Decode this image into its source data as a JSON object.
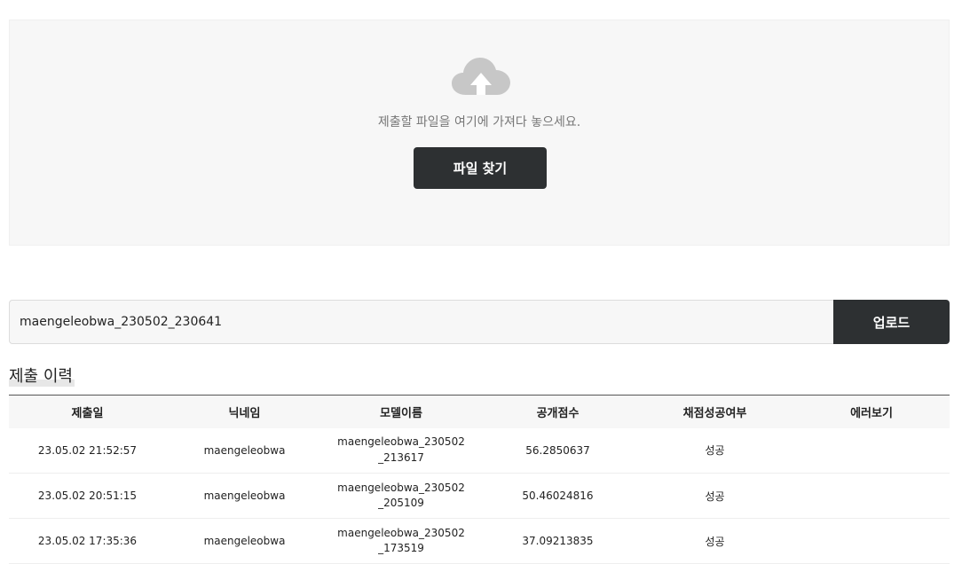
{
  "dropzone": {
    "hint": "제출할 파일을 여기에 가져다 놓으세요.",
    "find_button": "파일 찾기",
    "icon": "cloud-upload-icon"
  },
  "upload": {
    "value": "maengeleobwa_230502_230641",
    "button": "업로드"
  },
  "history": {
    "title": "제출 이력",
    "columns": [
      "제출일",
      "닉네임",
      "모델이름",
      "공개점수",
      "채점성공여부",
      "에러보기"
    ],
    "rows": [
      {
        "date": "23.05.02 21:52:57",
        "nickname": "maengeleobwa",
        "model": "maengeleobwa_230502_213617",
        "score": "56.2850637",
        "status": "성공",
        "error": ""
      },
      {
        "date": "23.05.02 20:51:15",
        "nickname": "maengeleobwa",
        "model": "maengeleobwa_230502_205109",
        "score": "50.46024816",
        "status": "성공",
        "error": ""
      },
      {
        "date": "23.05.02 17:35:36",
        "nickname": "maengeleobwa",
        "model": "maengeleobwa_230502_173519",
        "score": "37.09213835",
        "status": "성공",
        "error": ""
      }
    ]
  },
  "colors": {
    "dark_button": "#2d3032",
    "dropzone_bg": "#f7f7f7",
    "cloud_icon": "#c7c7c7"
  }
}
